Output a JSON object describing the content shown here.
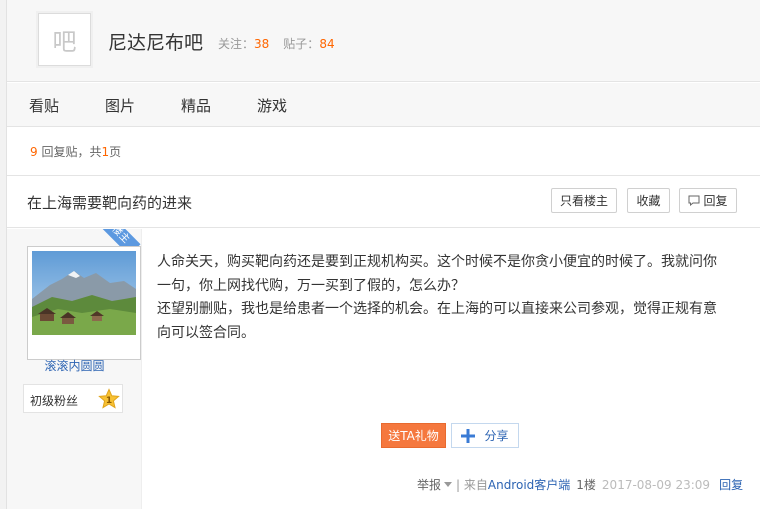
{
  "forum": {
    "avatar_glyph": "吧",
    "name": "尼达尼布吧",
    "follow_label": "关注：",
    "follow_count": "38",
    "posts_label": "贴子：",
    "posts_count": "84"
  },
  "nav": {
    "tabs": [
      {
        "label": "看贴"
      },
      {
        "label": "图片"
      },
      {
        "label": "精品"
      },
      {
        "label": "游戏"
      }
    ]
  },
  "thread_meta": {
    "reply_num": "9",
    "reply_text": " 回复贴，共",
    "page_num": "1",
    "page_suffix": "页"
  },
  "thread": {
    "title": "在上海需要靶向药的进来",
    "only_op_label": "只看楼主",
    "collect_label": "收藏",
    "reply_label": "回复"
  },
  "post": {
    "op_badge": "楼主",
    "author_name": "滚滚内圆圆",
    "fan_level_label": "初级粉丝",
    "fan_level_num": "1",
    "content_lines": [
      "人命关天，购买靶向药还是要到正规机构买。这个时候不是你贪小便宜的时候了。我就问你",
      "一句，你上网找代购，万一买到了假的，怎么办？",
      "还望别删贴，我也是给患者一个选择的机会。在上海的可以直接来公司参观，觉得正规有意",
      "向可以签合同。"
    ],
    "gift_label": "送TA礼物",
    "share_label": "分享",
    "footer": {
      "report_label": "举报",
      "from_prefix": "| 来自",
      "client_label": "Android客户端",
      "floor": "1楼",
      "date": "2017-08-09 23:09",
      "reply_label": "回复"
    }
  },
  "colors": {
    "accent_orange": "#f5783e",
    "link_blue": "#2d64b3",
    "count_orange": "#ff6600",
    "op_badge_blue": "#5c99e0"
  }
}
